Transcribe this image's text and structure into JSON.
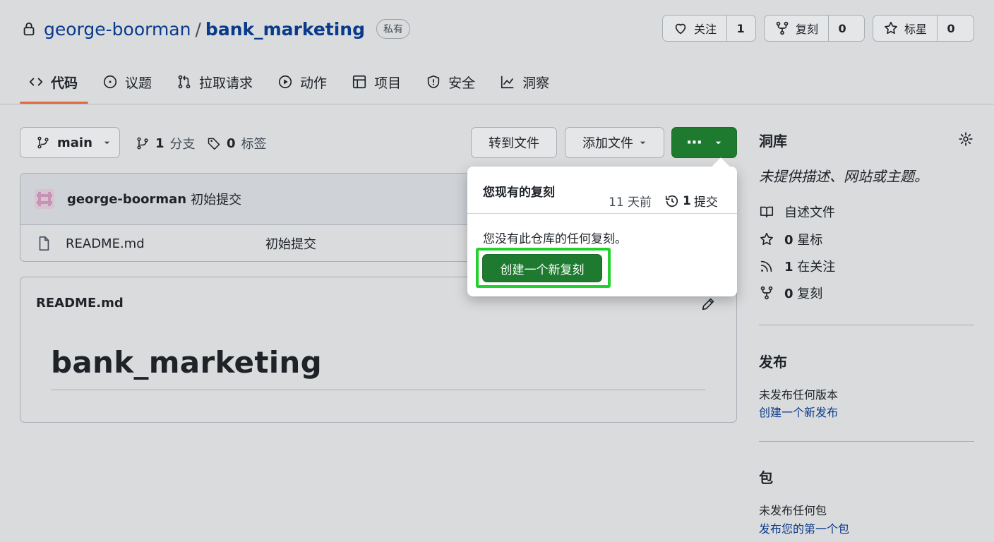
{
  "repo": {
    "owner": "george-boorman",
    "separator": "/",
    "name": "bank_marketing",
    "visibility": "私有"
  },
  "actions": {
    "watch": {
      "label": "关注",
      "count": "1"
    },
    "fork": {
      "label": "复刻",
      "count": "0"
    },
    "star": {
      "label": "标星",
      "count": "0"
    }
  },
  "tabs": [
    {
      "label": "代码",
      "icon": "code-icon"
    },
    {
      "label": "议题",
      "icon": "issue-icon"
    },
    {
      "label": "拉取请求",
      "icon": "pull-request-icon"
    },
    {
      "label": "动作",
      "icon": "play-icon"
    },
    {
      "label": "项目",
      "icon": "table-icon"
    },
    {
      "label": "安全",
      "icon": "shield-icon"
    },
    {
      "label": "洞察",
      "icon": "graph-icon"
    }
  ],
  "toolbar": {
    "branch": "main",
    "branches_count": "1",
    "branches_label": "分支",
    "tags_count": "0",
    "tags_label": "标签",
    "goto_file": "转到文件",
    "add_file": "添加文件",
    "code_button": "···"
  },
  "commit": {
    "author": "george-boorman",
    "message": "初始提交"
  },
  "files": [
    {
      "name": "README.md",
      "message": "初始提交"
    }
  ],
  "readme": {
    "filename": "README.md",
    "heading": "bank_marketing"
  },
  "popover": {
    "title": "您现有的复刻",
    "time": "11 天前",
    "commits_count": "1",
    "commits_label": "提交",
    "message": "您没有此仓库的任何复刻。",
    "create_button": "创建一个新复刻"
  },
  "sidebar": {
    "about_title": "洞库",
    "description": "未提供描述、网站或主题。",
    "readme_label": "自述文件",
    "stars_count": "0",
    "stars_label": "星标",
    "watching_count": "1",
    "watching_label": "在关注",
    "forks_count": "0",
    "forks_label": "复刻",
    "releases_title": "发布",
    "releases_text": "未发布任何版本",
    "releases_link": "创建一个新发布",
    "packages_title": "包",
    "packages_text": "未发布任何包",
    "packages_link": "发布您的第一个包"
  },
  "colors": {
    "accent_green": "#1d7a2f",
    "highlight_green": "#22d12d",
    "tab_underline": "#e1693f",
    "link_blue": "#0a3a8a"
  }
}
